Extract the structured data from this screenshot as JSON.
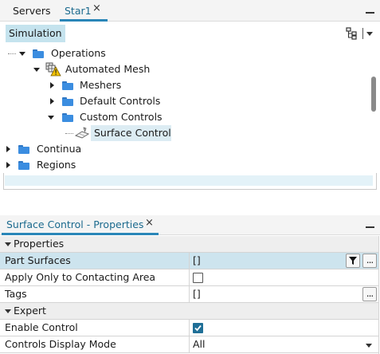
{
  "top_tabs": {
    "servers_label": "Servers",
    "star1_label": "Star1",
    "close_glyph": "×"
  },
  "tree": {
    "root_label": "Simulation",
    "toolbar_icons": [
      "tree-view-icon",
      "menu-dropdown-icon"
    ],
    "nodes": [
      {
        "label": "Operations",
        "icon": "folder-icon",
        "expanded": true
      },
      {
        "label": "Automated Mesh",
        "icon": "automated-mesh-warning-icon",
        "expanded": true
      },
      {
        "label": "Meshers",
        "icon": "folder-icon",
        "expanded": false
      },
      {
        "label": "Default Controls",
        "icon": "folder-icon",
        "expanded": false
      },
      {
        "label": "Custom Controls",
        "icon": "folder-icon",
        "expanded": true
      },
      {
        "label": "Surface Control",
        "icon": "surface-control-icon",
        "selected": true
      },
      {
        "label": "Continua",
        "icon": "folder-icon",
        "expanded": false
      },
      {
        "label": "Regions",
        "icon": "folder-icon",
        "expanded": false
      }
    ]
  },
  "properties": {
    "tab_label": "Surface Control - Properties",
    "close_glyph": "×",
    "rows": [
      {
        "kind": "category",
        "name": "Properties"
      },
      {
        "kind": "property",
        "name": "Part Surfaces",
        "value": "[]",
        "selected": true,
        "buttons": [
          "filter-icon",
          "ellipsis-button"
        ]
      },
      {
        "kind": "property",
        "name": "Apply Only to Contacting Area",
        "checkbox": false
      },
      {
        "kind": "property",
        "name": "Tags",
        "value": "[]",
        "buttons": [
          "ellipsis-button"
        ]
      },
      {
        "kind": "category",
        "name": "Expert"
      },
      {
        "kind": "property",
        "name": "Enable Control",
        "checkbox": true
      },
      {
        "kind": "property",
        "name": "Controls Display Mode",
        "value": "All",
        "dropdown": true
      }
    ],
    "ellipsis_glyph": "..."
  },
  "colors": {
    "accent": "#2a86b8",
    "selection": "#c5e3ee",
    "folder": "#3b8de0",
    "warning": "#f2c200"
  }
}
